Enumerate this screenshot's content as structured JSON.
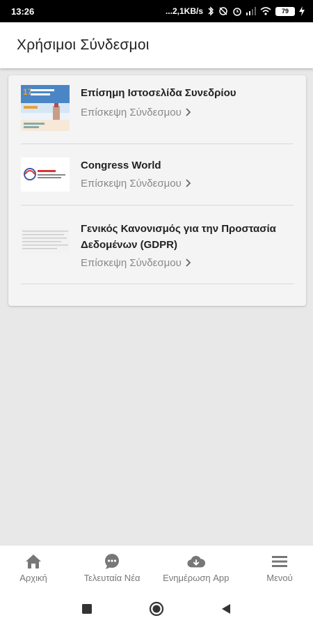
{
  "status_bar": {
    "time": "13:26",
    "network_speed": "...2,1KB/s",
    "battery": "79"
  },
  "header": {
    "title": "Χρήσιμοι Σύνδεσμοι"
  },
  "links": [
    {
      "title": "Επίσημη Ιστοσελίδα Συνεδρίου",
      "action": "Επίσκεψη Σύνδεσμου"
    },
    {
      "title": "Congress World",
      "action": "Επίσκεψη Σύνδεσμου"
    },
    {
      "title": "Γενικός Κανονισμός για την Προστασία Δεδομένων (GDPR)",
      "action": "Επίσκεψη Σύνδεσμου"
    }
  ],
  "bottom_nav": [
    {
      "label": "Αρχική",
      "icon": "home-icon"
    },
    {
      "label": "Τελευταία Νέα",
      "icon": "chat-bubble-icon"
    },
    {
      "label": "Ενημέρωση App",
      "icon": "cloud-download-icon"
    },
    {
      "label": "Μενού",
      "icon": "hamburger-menu-icon"
    }
  ],
  "colors": {
    "icon_gray": "#777777",
    "background": "#e8e8e8",
    "card": "#f4f4f5"
  }
}
